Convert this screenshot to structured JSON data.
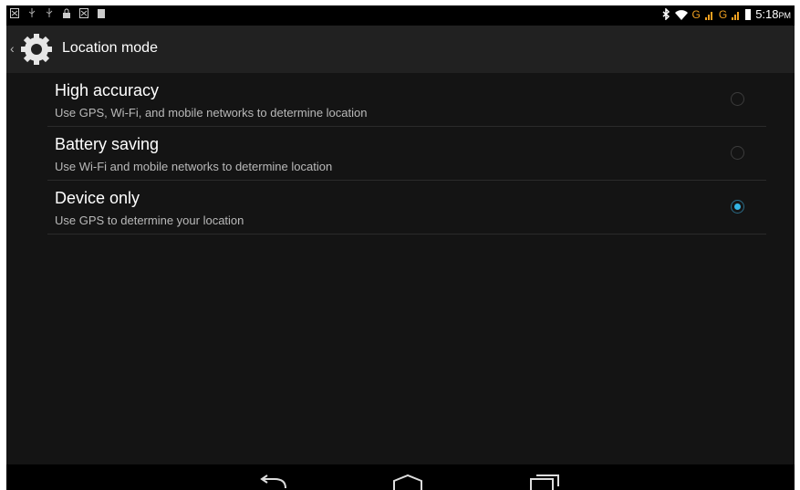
{
  "status_bar": {
    "left_icons": [
      "notification-icon",
      "usb-icon",
      "usb-debug-icon",
      "lock-icon",
      "notification-icon",
      "sd-card-icon"
    ],
    "network_label_1": "G",
    "network_label_2": "G",
    "time": "5:18",
    "ampm": "PM"
  },
  "action_bar": {
    "title": "Location mode",
    "icon": "gear-icon"
  },
  "options": [
    {
      "title": "High accuracy",
      "subtitle": "Use GPS, Wi-Fi, and mobile networks to determine location",
      "selected": false
    },
    {
      "title": "Battery saving",
      "subtitle": "Use Wi-Fi and mobile networks to determine location",
      "selected": false
    },
    {
      "title": "Device only",
      "subtitle": "Use GPS to determine your location",
      "selected": true
    }
  ],
  "nav_bar": {
    "buttons": [
      "back-icon",
      "home-icon",
      "recents-icon"
    ]
  },
  "colors": {
    "accent": "#33b5e5",
    "background": "#141414",
    "action_bar": "#212121",
    "signal": "#f0a020"
  }
}
